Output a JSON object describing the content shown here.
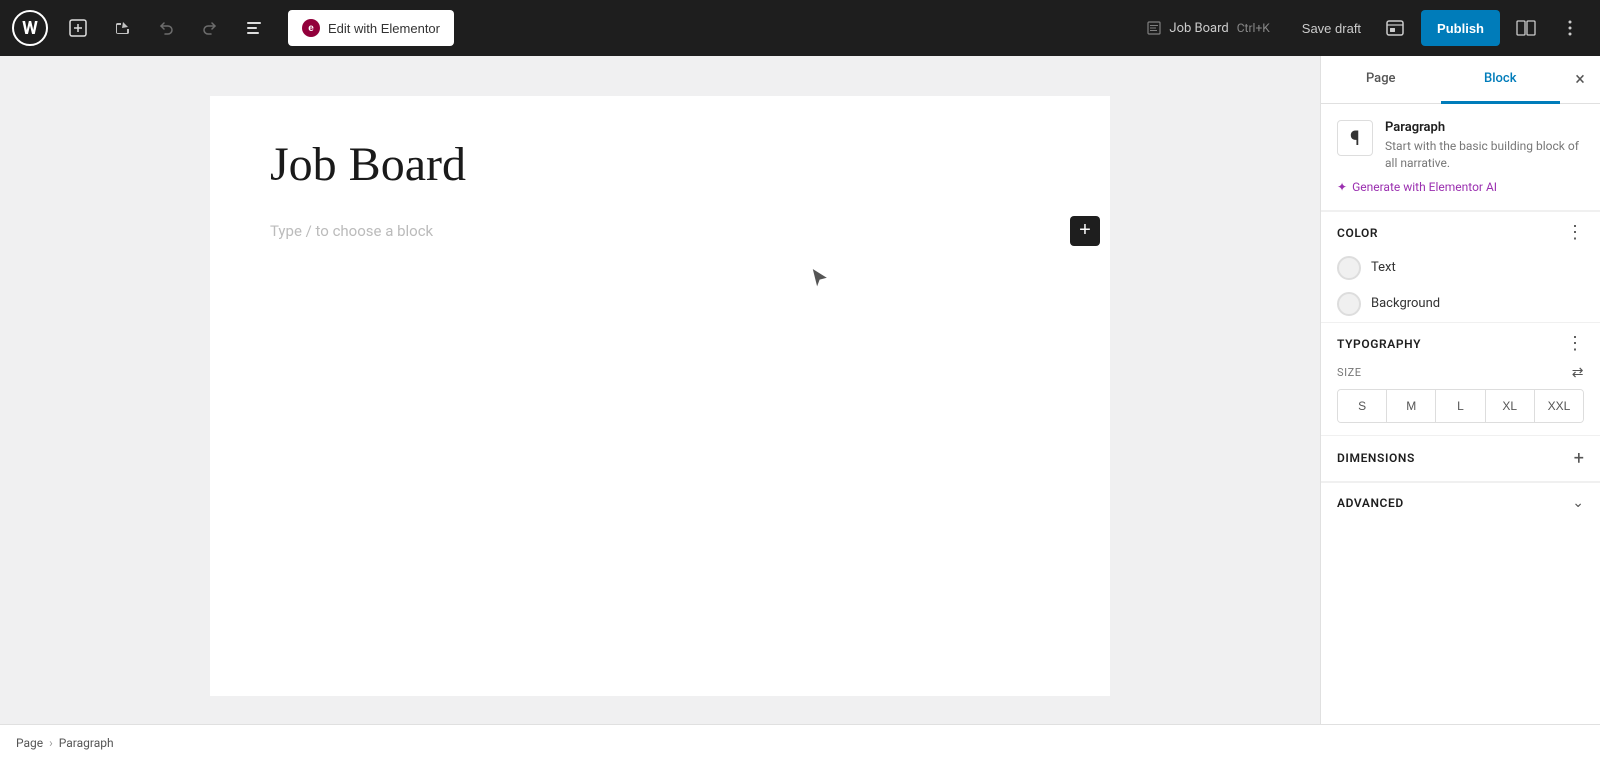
{
  "toolbar": {
    "wp_logo_text": "W",
    "add_button_label": "+",
    "undo_button_label": "↩",
    "redo_button_label": "↪",
    "tools_button_label": "≡",
    "elementor_button_label": "Edit with Elementor",
    "elementor_icon": "e",
    "search_placeholder": "",
    "post_icon": "☰",
    "post_title": "Job Board",
    "shortcut": "Ctrl+K",
    "save_draft_label": "Save draft",
    "publish_label": "Publish",
    "settings_icon": "⊞"
  },
  "editor": {
    "page_title": "Job Board",
    "block_placeholder": "Type / to choose a block",
    "add_block_label": "+"
  },
  "breadcrumb": {
    "page_label": "Page",
    "separator": "›",
    "current_label": "Paragraph"
  },
  "right_panel": {
    "tabs": {
      "page_label": "Page",
      "block_label": "Block"
    },
    "close_icon": "×",
    "block": {
      "icon": "¶",
      "title": "Paragraph",
      "description": "Start with the basic building block of all narrative.",
      "generate_label": "Generate with Elementor AI",
      "generate_icon": "✦"
    },
    "color": {
      "section_title": "Color",
      "more_icon": "⋮",
      "text_label": "Text",
      "background_label": "Background"
    },
    "typography": {
      "section_title": "Typography",
      "more_icon": "⋮",
      "size_label": "SIZE",
      "adjust_icon": "⇄",
      "sizes": [
        "S",
        "M",
        "L",
        "XL",
        "XXL"
      ]
    },
    "dimensions": {
      "section_title": "Dimensions",
      "add_icon": "+"
    },
    "advanced": {
      "section_title": "Advanced",
      "chevron_icon": "∨"
    }
  }
}
